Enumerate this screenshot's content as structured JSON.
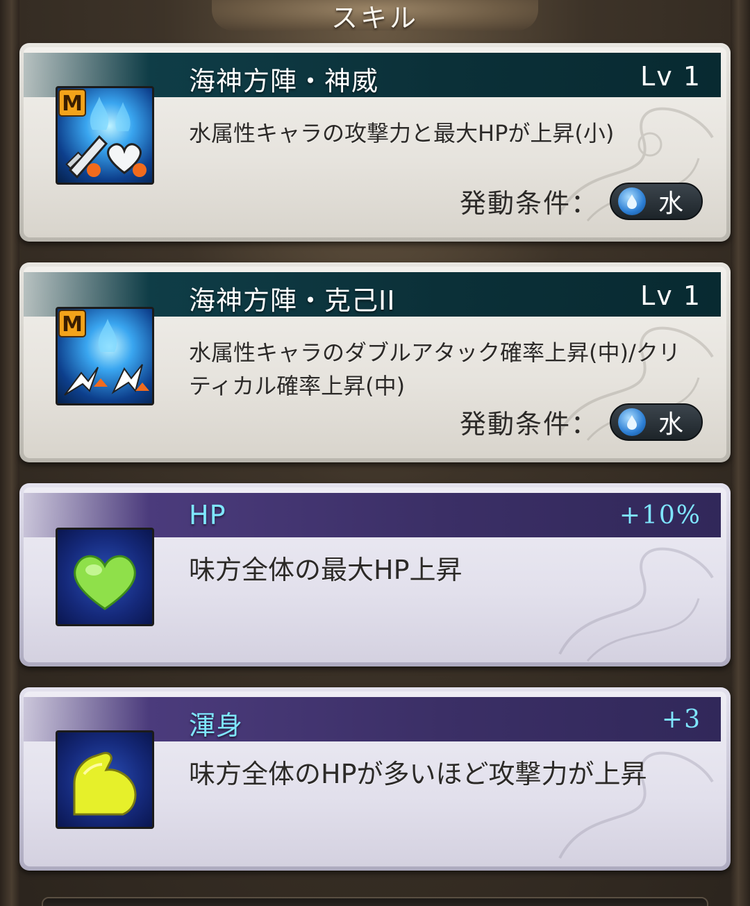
{
  "header": {
    "title": "スキル"
  },
  "skills": [
    {
      "name": "海神方陣・神威",
      "level": "Lv 1",
      "description": "水属性キャラの攻撃力と最大HPが上昇(小)",
      "icon": "magna-might-hp-icon",
      "icon_badge": "M",
      "condition_label": "発動条件：",
      "condition_value": "水"
    },
    {
      "name": "海神方陣・克己II",
      "level": "Lv 1",
      "description": "水属性キャラのダブルアタック確率上昇(中)/クリティカル確率上昇(中)",
      "icon": "magna-da-crit-icon",
      "icon_badge": "M",
      "condition_label": "発動条件：",
      "condition_value": "水"
    },
    {
      "name": "HP",
      "level": "+10%",
      "description": "味方全体の最大HP上昇",
      "icon": "green-heart-icon"
    },
    {
      "name": "渾身",
      "level": "+3",
      "description": "味方全体のHPが多いほど攻撃力が上昇",
      "icon": "yellow-arm-icon"
    }
  ],
  "colors": {
    "teal_bar": "#0b3038",
    "purple_bar": "#3b2f66",
    "cyan_text": "#7fe6ff",
    "water_blue": "#2d7fd4"
  }
}
